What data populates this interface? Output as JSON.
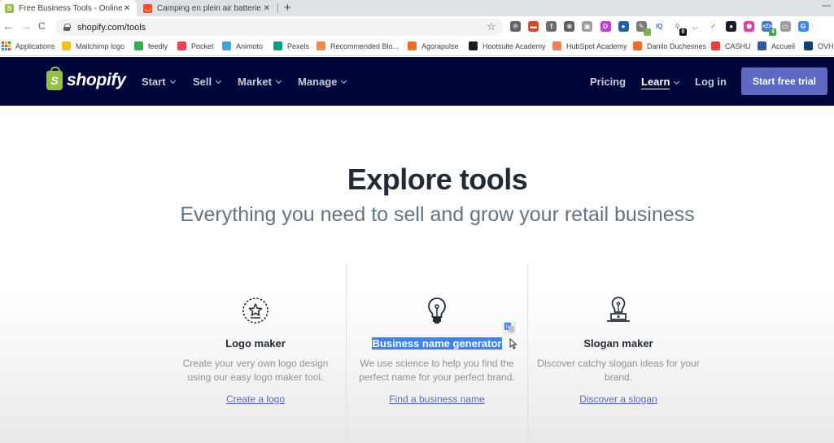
{
  "browser": {
    "tabs": [
      {
        "title": "Free Business Tools - Online Tool",
        "favicon": "shopify-bag-icon",
        "active": true
      },
      {
        "title": "Camping en plein air batterie de",
        "favicon": "aliexpress-icon",
        "active": false
      }
    ],
    "close_glyph": "✕",
    "new_tab_glyph": "+",
    "minimize_glyph": "—",
    "nav": {
      "back": "←",
      "forward": "→",
      "reload": "C"
    },
    "url": "shopify.com/tools",
    "star_glyph": "☆",
    "extensions": [
      {
        "name": "pinterest",
        "color": "#5f6368",
        "glyph": "℗",
        "badge": null
      },
      {
        "name": "pdf",
        "color": "#d9452b",
        "glyph": "▬",
        "badge": null
      },
      {
        "name": "facebook",
        "color": "#6d6d6d",
        "glyph": "f",
        "badge": null
      },
      {
        "name": "ublock",
        "color": "#5f6368",
        "glyph": "⊗",
        "badge": null
      },
      {
        "name": "screenshot",
        "color": "#9e9e9e",
        "glyph": "▣",
        "badge": null
      },
      {
        "name": "dareboost",
        "color": "#c03cd8",
        "glyph": "D",
        "badge": null
      },
      {
        "name": "avatar-ext",
        "color": "#1e5fa8",
        "glyph": "●",
        "badge": null
      },
      {
        "name": "color-picker",
        "color": "#7a7a7a",
        "glyph": "✎",
        "badge": {
          "text": "",
          "color": "#7cb342"
        }
      },
      {
        "name": "iq",
        "color": "#ffffff",
        "glyph": "IQ",
        "badge": null
      },
      {
        "name": "link-ext",
        "color": "#ffffff",
        "glyph": "⚲",
        "badge": {
          "text": "0",
          "color": "#111111"
        }
      },
      {
        "name": "pocket",
        "color": "#ffffff",
        "glyph": "◡",
        "badge": null
      },
      {
        "name": "todo-check",
        "color": "#ffffff",
        "glyph": "✓",
        "badge": null
      },
      {
        "name": "dark-circle",
        "color": "#1a1a2e",
        "glyph": "●",
        "badge": null
      },
      {
        "name": "pink-ext",
        "color": "#ea3ba8",
        "glyph": "⬢",
        "badge": null
      },
      {
        "name": "code-ext",
        "color": "#4a7bd0",
        "glyph": "</>",
        "badge": {
          "text": "4",
          "color": "#43a047"
        }
      },
      {
        "name": "tab-ext",
        "color": "#9e9e9e",
        "glyph": "▭",
        "badge": null
      },
      {
        "name": "google-translate",
        "color": "#4285f4",
        "glyph": "G",
        "badge": null
      }
    ],
    "bookmarks": [
      {
        "label": "Applications",
        "icon": "apps-grid-icon",
        "color": ""
      },
      {
        "label": "Mailchimp logo",
        "icon": "mailchimp-icon",
        "color": "#f2c21a"
      },
      {
        "label": "feedly",
        "icon": "feedly-icon",
        "color": "#2bb24c"
      },
      {
        "label": "Pocket",
        "icon": "pocket-icon",
        "color": "#ef4056"
      },
      {
        "label": "Animoto",
        "icon": "animoto-icon",
        "color": "#4a9fd8"
      },
      {
        "label": "Pexels",
        "icon": "pexels-icon",
        "color": "#05a081"
      },
      {
        "label": "Recommended Blo...",
        "icon": "recommended-icon",
        "color": "#f08a4b"
      },
      {
        "label": "Agorapulse",
        "icon": "agorapulse-icon",
        "color": "#f26b21"
      },
      {
        "label": "Hootsuite Academy",
        "icon": "hootsuite-icon",
        "color": "#1c1c1c"
      },
      {
        "label": "HubSpot Academy",
        "icon": "hubspot-icon",
        "color": "#ff7a59"
      },
      {
        "label": "Danilo Duchesnes",
        "icon": "danilo-icon",
        "color": "#f26b21"
      },
      {
        "label": "CASHU",
        "icon": "cashu-icon",
        "color": "#e83e3e"
      },
      {
        "label": "Accueil",
        "icon": "facebook-icon",
        "color": "#3b5998"
      },
      {
        "label": "OVH",
        "icon": "ovh-icon",
        "color": "#123f6d"
      }
    ]
  },
  "site": {
    "brand": "shopify",
    "brand_color": "#95bf47",
    "header_bg": "#000639",
    "nav": [
      {
        "label": "Start",
        "dropdown": true
      },
      {
        "label": "Sell",
        "dropdown": true
      },
      {
        "label": "Market",
        "dropdown": true
      },
      {
        "label": "Manage",
        "dropdown": true
      }
    ],
    "right_nav": {
      "pricing": "Pricing",
      "learn": "Learn",
      "login": "Log in",
      "cta": "Start free trial"
    },
    "cta_color": "#5c6ac4"
  },
  "main": {
    "title": "Explore tools",
    "subtitle": "Everything you need to sell and grow your retail business",
    "tools": [
      {
        "icon": "logo-maker-icon",
        "name": "Logo maker",
        "description": "Create your very own logo design using our easy logo maker tool.",
        "link": "Create a logo",
        "selected": false
      },
      {
        "icon": "lightbulb-icon",
        "name": "Business name generator",
        "description": "We use science to help you find the perfect name for your perfect brand.",
        "link": "Find a business name",
        "selected": true
      },
      {
        "icon": "slogan-maker-icon",
        "name": "Slogan maker",
        "description": "Discover catchy slogan ideas for your brand.",
        "link": "Discover a slogan",
        "selected": false
      }
    ]
  }
}
